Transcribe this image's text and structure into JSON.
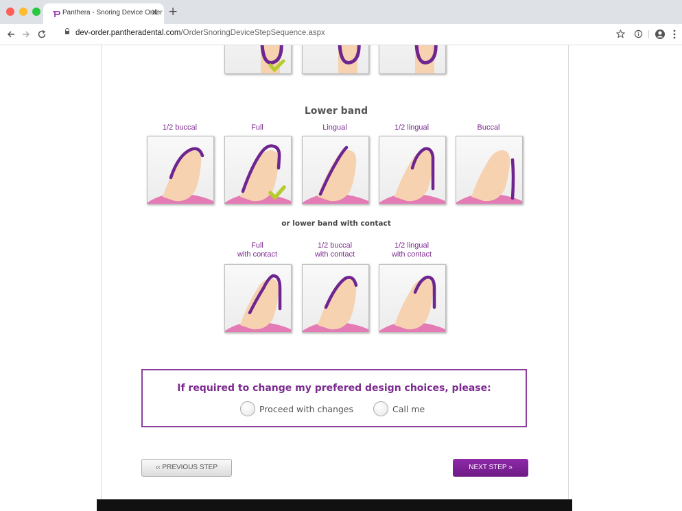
{
  "browser": {
    "tab_title": "Panthera - Snoring Device Order",
    "close_glyph": "×",
    "new_tab_glyph": "+",
    "url_host": "dev-order.pantheradental.com",
    "url_path": "/OrderSnoringDeviceStepSequence.aspx",
    "icons": [
      "back-arrow-icon",
      "forward-arrow-icon",
      "reload-icon",
      "lock-icon",
      "star-icon",
      "info-icon",
      "account-icon",
      "menu-dots-icon"
    ]
  },
  "lower_band": {
    "title": "Lower band",
    "options": [
      {
        "label": "1/2 buccal",
        "selected": false
      },
      {
        "label": "Full",
        "selected": true
      },
      {
        "label": "Lingual",
        "selected": false
      },
      {
        "label": "1/2 lingual",
        "selected": false
      },
      {
        "label": "Buccal",
        "selected": false
      }
    ]
  },
  "lower_band_contact": {
    "title": "or lower band with contact",
    "options": [
      {
        "label_line1": "Full",
        "label_line2": "with contact"
      },
      {
        "label_line1": "1/2 buccal",
        "label_line2": "with contact"
      },
      {
        "label_line1": "1/2 lingual",
        "label_line2": "with contact"
      }
    ]
  },
  "choices": {
    "title": "If required to change my prefered design choices, please:",
    "option_proceed": "Proceed with changes",
    "option_call": "Call me"
  },
  "nav": {
    "prev_label": "‹‹ PREVIOUS STEP",
    "next_label": "NEXT STEP »"
  },
  "colors": {
    "accent_purple": "#7b2a8e",
    "band_purple": "#6e2590",
    "check_green": "#b6cc2c",
    "gum_pink": "#e57bb5",
    "tooth": "#f6d2b0"
  }
}
